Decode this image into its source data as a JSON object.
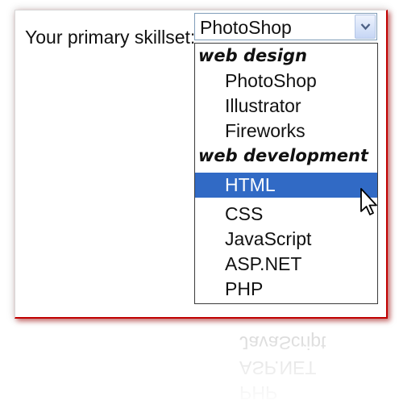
{
  "form": {
    "label": "Your primary skillset:",
    "selected_value": "PhotoShop",
    "highlighted_option": "HTML"
  },
  "dropdown": {
    "groups": [
      {
        "label": "web design",
        "options": [
          "PhotoShop",
          "Illustrator",
          "Fireworks"
        ]
      },
      {
        "label": "web development",
        "options": [
          "HTML",
          "CSS",
          "JavaScript",
          "ASP.NET",
          "PHP"
        ]
      }
    ]
  },
  "icons": {
    "dropdown_arrow": "chevron-down-icon",
    "cursor": "mouse-pointer-icon"
  },
  "colors": {
    "selection": "#316ac5",
    "panel_border": "#c00000"
  }
}
